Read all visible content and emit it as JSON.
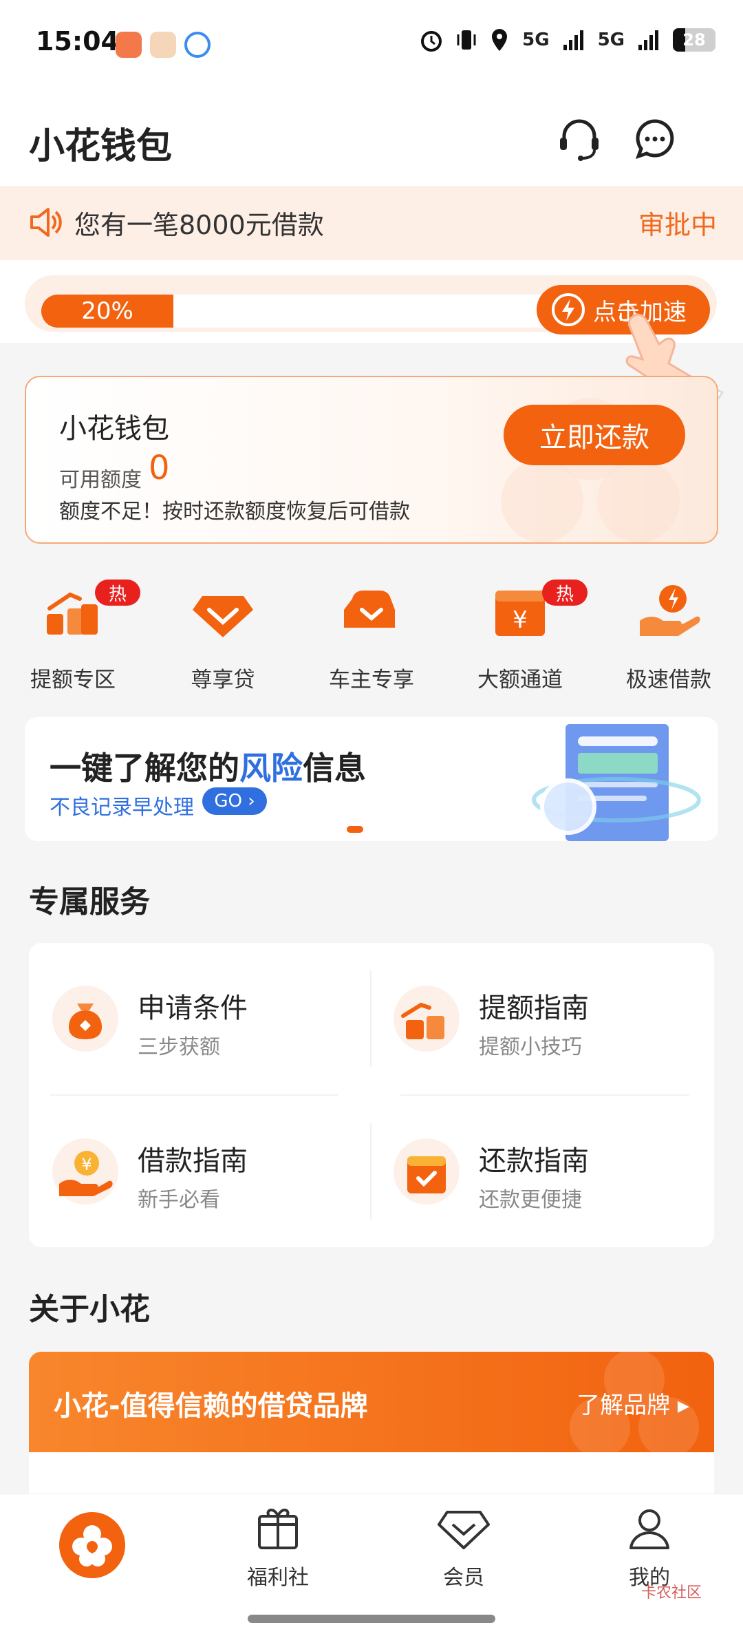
{
  "status_bar": {
    "time": "15:04",
    "network1": "5G",
    "network2": "5G",
    "battery": "28"
  },
  "header": {
    "title": "小花钱包"
  },
  "notice": {
    "text": "您有一笔8000元借款",
    "status": "审批中"
  },
  "progress": {
    "percent_label": "20%",
    "speed_button": "点击加速"
  },
  "wallet": {
    "title": "小花钱包",
    "quota_label": "可用额度",
    "quota_value": "0",
    "tip": "额度不足！按时还款额度恢复后可借款",
    "repay_button": "立即还款"
  },
  "quick_menu": [
    {
      "label": "提额专区",
      "badge": "热"
    },
    {
      "label": "尊享贷"
    },
    {
      "label": "车主专享"
    },
    {
      "label": "大额通道",
      "badge": "热"
    },
    {
      "label": "极速借款"
    }
  ],
  "banner": {
    "title_pre": "一键了解您的",
    "title_hl": "风险",
    "title_post": "信息",
    "subtitle": "不良记录早处理",
    "go_label": "GO",
    "go_arrow": "›"
  },
  "services": {
    "title": "专属服务",
    "items": [
      {
        "title": "申请条件",
        "sub": "三步获额"
      },
      {
        "title": "提额指南",
        "sub": "提额小技巧"
      },
      {
        "title": "借款指南",
        "sub": "新手必看"
      },
      {
        "title": "还款指南",
        "sub": "还款更便捷"
      }
    ]
  },
  "about": {
    "title": "关于小花",
    "brand_title": "小花-值得信赖的借贷品牌",
    "brand_link": "了解品牌 ▸"
  },
  "tabbar": {
    "tabs": [
      {
        "label": ""
      },
      {
        "label": "福利社"
      },
      {
        "label": "会员"
      },
      {
        "label": "我的"
      }
    ]
  },
  "watermark": "卡农社区",
  "colors": {
    "accent": "#f2620f",
    "notice_bg": "#fdeee6",
    "link_blue": "#2f6fe0",
    "hot_red": "#e8211f"
  }
}
